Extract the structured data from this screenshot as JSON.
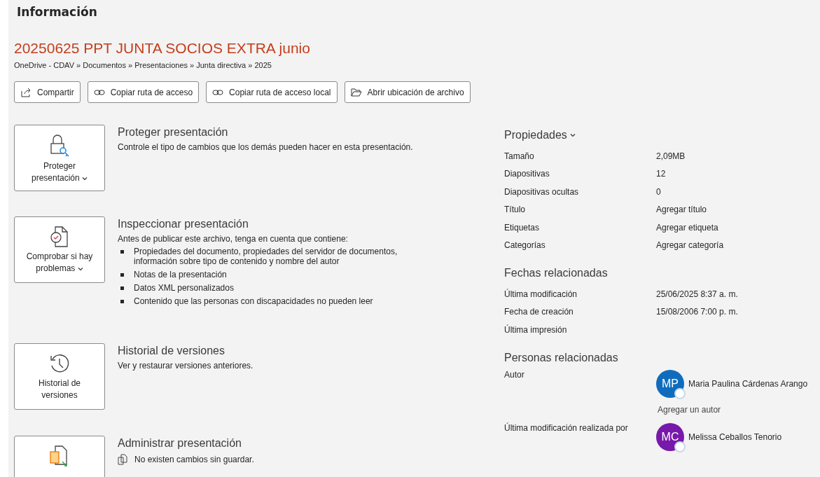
{
  "page_title": "Información",
  "document": {
    "title": "20250625 PPT JUNTA SOCIOS EXTRA junio",
    "path": "OneDrive - CDAV » Documentos » Presentaciones » Junta directiva » 2025"
  },
  "actions": [
    {
      "kind": "share",
      "label": "Compartir"
    },
    {
      "kind": "link",
      "label": "Copiar ruta de acceso"
    },
    {
      "kind": "link",
      "label": "Copiar ruta de acceso local"
    },
    {
      "kind": "folder",
      "label": "Abrir ubicación de archivo"
    }
  ],
  "sections": [
    {
      "kind": "protect",
      "button": [
        "Proteger",
        "presentación"
      ],
      "dropdown": true,
      "title": "Proteger presentación",
      "description": "Controle el tipo de cambios que los demás pueden hacer en esta presentación."
    },
    {
      "kind": "inspect",
      "button": [
        "Comprobar si hay",
        "problemas"
      ],
      "dropdown": true,
      "title": "Inspeccionar presentación",
      "description": "Antes de publicar este archivo, tenga en cuenta que contiene:",
      "bullets": [
        "Propiedades del documento, propiedades del servidor de documentos, información sobre tipo de contenido y nombre del autor",
        "Notas de la presentación",
        "Datos XML personalizados",
        "Contenido que las personas con discapacidades no pueden leer"
      ]
    },
    {
      "kind": "history",
      "button": [
        "Historial de",
        "versiones"
      ],
      "dropdown": false,
      "title": "Historial de versiones",
      "description": "Ver y restaurar versiones anteriores."
    },
    {
      "kind": "manage",
      "title": "Administrar presentación",
      "note": "No existen cambios sin guardar."
    }
  ],
  "properties": {
    "heading": "Propiedades",
    "rows": [
      {
        "label": "Tamaño",
        "value": "2,09MB"
      },
      {
        "label": "Diapositivas",
        "value": "12"
      },
      {
        "label": "Diapositivas ocultas",
        "value": "0"
      },
      {
        "label": "Título",
        "value": "Agregar título"
      },
      {
        "label": "Etiquetas",
        "value": "Agregar etiqueta"
      },
      {
        "label": "Categorías",
        "value": "Agregar categoría"
      }
    ]
  },
  "dates": {
    "heading": "Fechas relacionadas",
    "rows": [
      {
        "label": "Última modificación",
        "value": "25/06/2025 8:37 a. m."
      },
      {
        "label": "Fecha de creación",
        "value": "15/08/2006 7:00 p. m."
      },
      {
        "label": "Última impresión"
      }
    ]
  },
  "people": {
    "heading": "Personas relacionadas",
    "groups": [
      {
        "label": "Autor",
        "person": {
          "initials": "MP",
          "name": "Maria Paulina Cárdenas Arango",
          "color": "#0f6cbd"
        },
        "add_link": "Agregar un autor"
      },
      {
        "label": "Última modificación realizada por",
        "person": {
          "initials": "MC",
          "name": "Melissa Ceballos Tenorio",
          "color": "#7719aa"
        }
      }
    ]
  }
}
